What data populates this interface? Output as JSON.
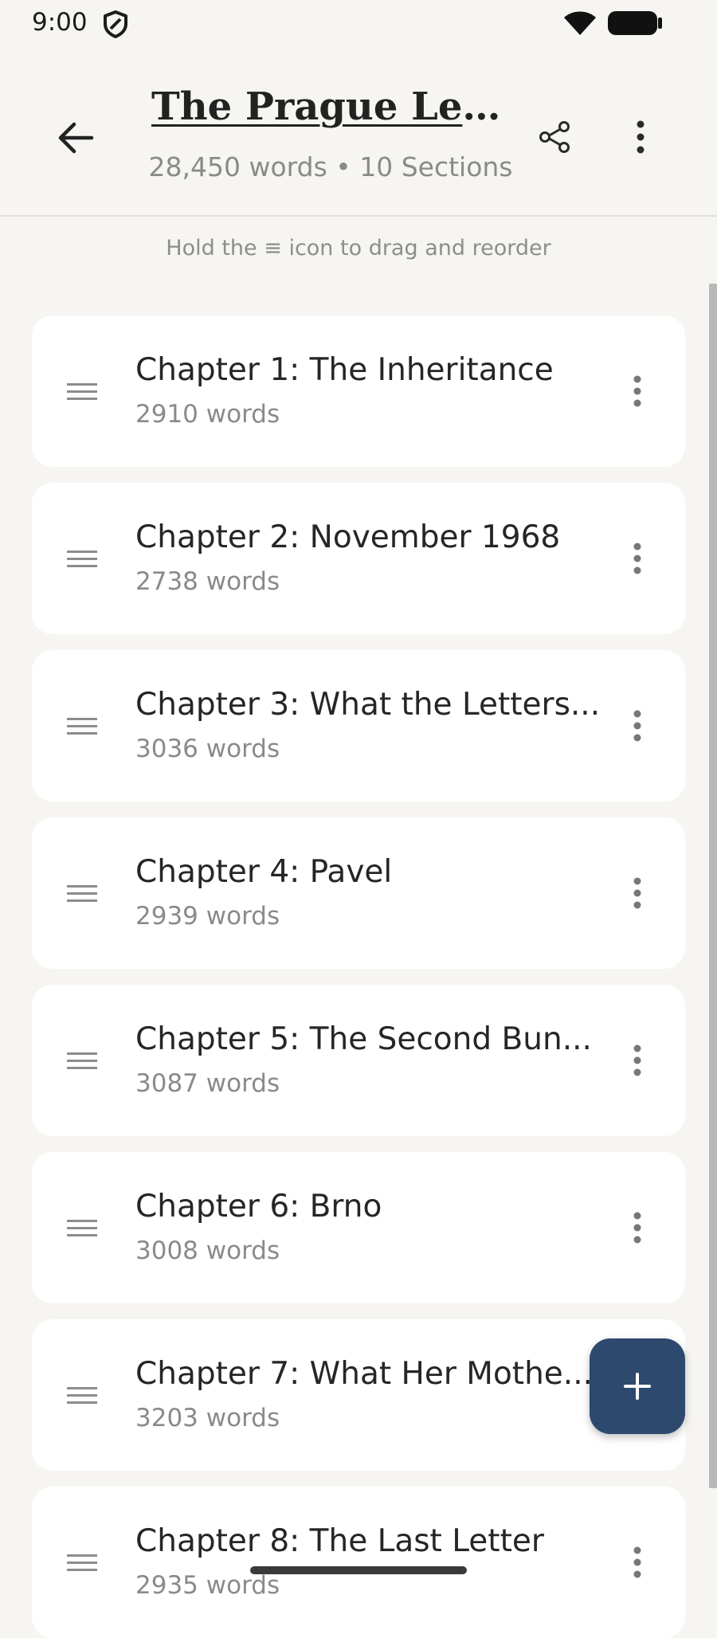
{
  "status_bar": {
    "time": "9:00",
    "icons": [
      "shield-icon",
      "wifi-icon",
      "battery-icon"
    ]
  },
  "header": {
    "title": "The Prague Lett...",
    "subtitle": "28,450 words • 10 Sections",
    "icons": [
      "arrow-left-icon",
      "share-icon",
      "more-vertical-icon"
    ]
  },
  "hint": "Hold the ≡ icon to drag and reorder",
  "chapters": [
    {
      "title": "Chapter 1: The Inheritance",
      "words": "2910 words"
    },
    {
      "title": "Chapter 2: November 1968",
      "words": "2738 words"
    },
    {
      "title": "Chapter 3: What the Letters...",
      "words": "3036 words"
    },
    {
      "title": "Chapter 4: Pavel",
      "words": "2939 words"
    },
    {
      "title": "Chapter 5: The Second Bun...",
      "words": "3087 words"
    },
    {
      "title": "Chapter 6: Brno",
      "words": "3008 words"
    },
    {
      "title": "Chapter 7: What Her Mothe...",
      "words": "3203 words"
    },
    {
      "title": "Chapter 8: The Last Letter",
      "words": "2935 words"
    }
  ],
  "fab": {
    "icon": "plus-icon"
  },
  "colors": {
    "background": "#f6f5f1",
    "card": "#ffffff",
    "fab": "#2d4a6e",
    "muted_text": "#8a8a8a"
  }
}
